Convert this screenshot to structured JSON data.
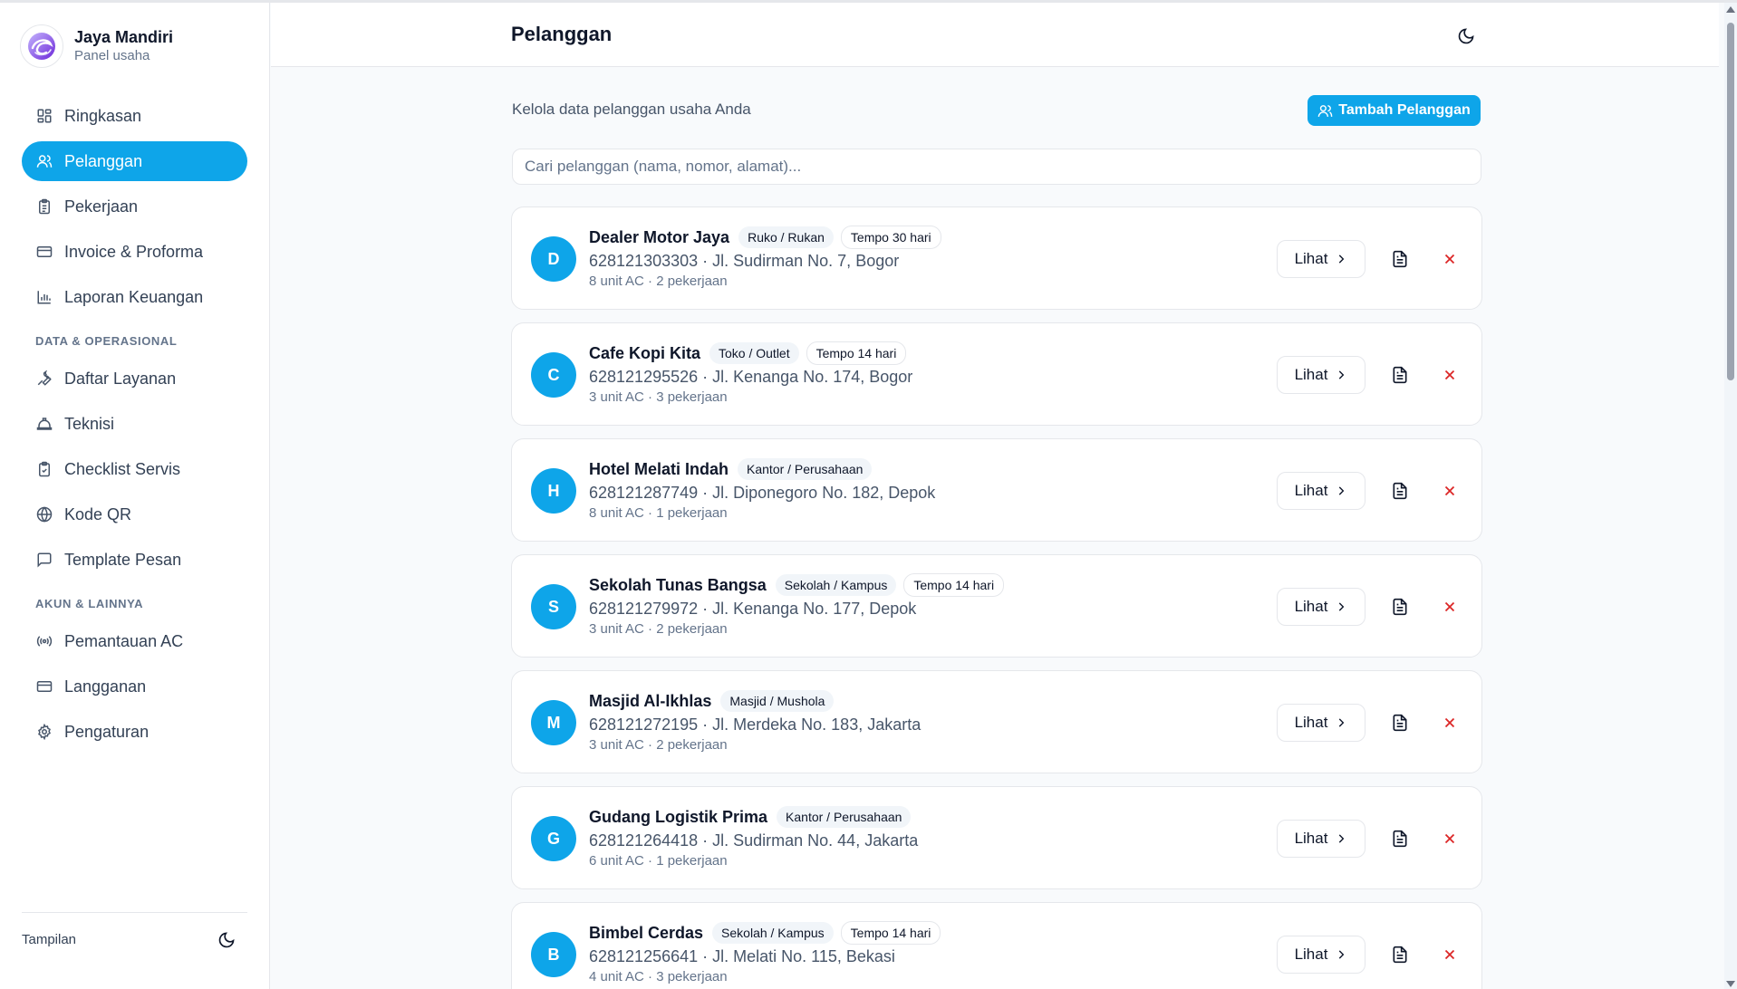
{
  "brand": {
    "name": "Jaya Mandiri",
    "subtitle": "Panel usaha"
  },
  "nav": {
    "main": [
      {
        "label": "Ringkasan",
        "icon": "dashboard-icon",
        "active": false
      },
      {
        "label": "Pelanggan",
        "icon": "users-icon",
        "active": true
      },
      {
        "label": "Pekerjaan",
        "icon": "clipboard-icon",
        "active": false
      },
      {
        "label": "Invoice & Proforma",
        "icon": "credit-card-icon",
        "active": false
      },
      {
        "label": "Laporan Keuangan",
        "icon": "bar-chart-icon",
        "active": false
      }
    ],
    "section_data": "DATA & OPERASIONAL",
    "data": [
      {
        "label": "Daftar Layanan",
        "icon": "wrench-icon"
      },
      {
        "label": "Teknisi",
        "icon": "hard-hat-icon"
      },
      {
        "label": "Checklist Servis",
        "icon": "clipboard-check-icon"
      },
      {
        "label": "Kode QR",
        "icon": "globe-icon"
      },
      {
        "label": "Template Pesan",
        "icon": "message-icon"
      }
    ],
    "section_account": "AKUN & LAINNYA",
    "account": [
      {
        "label": "Pemantauan AC",
        "icon": "radio-icon"
      },
      {
        "label": "Langganan",
        "icon": "credit-card-icon"
      },
      {
        "label": "Pengaturan",
        "icon": "gear-icon"
      }
    ]
  },
  "footer": {
    "label": "Tampilan"
  },
  "header": {
    "title": "Pelanggan"
  },
  "main": {
    "subtitle": "Kelola data pelanggan usaha Anda",
    "add_button": "Tambah Pelanggan",
    "search_placeholder": "Cari pelanggan (nama, nomor, alamat)..."
  },
  "colors": {
    "accent": "#0ea5e9",
    "danger": "#dc2626"
  },
  "action_labels": {
    "view": "Lihat"
  },
  "customers": [
    {
      "initial": "D",
      "name": "Dealer Motor Jaya",
      "tags": [
        "Ruko / Rukan"
      ],
      "terms": "Tempo 30 hari",
      "contact": "628121303303 · Jl. Sudirman No. 7, Bogor",
      "stats": "8 unit AC · 2 pekerjaan"
    },
    {
      "initial": "C",
      "name": "Cafe Kopi Kita",
      "tags": [
        "Toko / Outlet"
      ],
      "terms": "Tempo 14 hari",
      "contact": "628121295526 · Jl. Kenanga No. 174, Bogor",
      "stats": "3 unit AC · 3 pekerjaan"
    },
    {
      "initial": "H",
      "name": "Hotel Melati Indah",
      "tags": [
        "Kantor / Perusahaan"
      ],
      "terms": "",
      "contact": "628121287749 · Jl. Diponegoro No. 182, Depok",
      "stats": "8 unit AC · 1 pekerjaan"
    },
    {
      "initial": "S",
      "name": "Sekolah Tunas Bangsa",
      "tags": [
        "Sekolah / Kampus"
      ],
      "terms": "Tempo 14 hari",
      "contact": "628121279972 · Jl. Kenanga No. 177, Depok",
      "stats": "3 unit AC · 2 pekerjaan"
    },
    {
      "initial": "M",
      "name": "Masjid Al-Ikhlas",
      "tags": [
        "Masjid / Mushola"
      ],
      "terms": "",
      "contact": "628121272195 · Jl. Merdeka No. 183, Jakarta",
      "stats": "3 unit AC · 2 pekerjaan"
    },
    {
      "initial": "G",
      "name": "Gudang Logistik Prima",
      "tags": [
        "Kantor / Perusahaan"
      ],
      "terms": "",
      "contact": "628121264418 · Jl. Sudirman No. 44, Jakarta",
      "stats": "6 unit AC · 1 pekerjaan"
    },
    {
      "initial": "B",
      "name": "Bimbel Cerdas",
      "tags": [
        "Sekolah / Kampus"
      ],
      "terms": "Tempo 14 hari",
      "contact": "628121256641 · Jl. Melati No. 115, Bekasi",
      "stats": "4 unit AC · 3 pekerjaan"
    }
  ]
}
